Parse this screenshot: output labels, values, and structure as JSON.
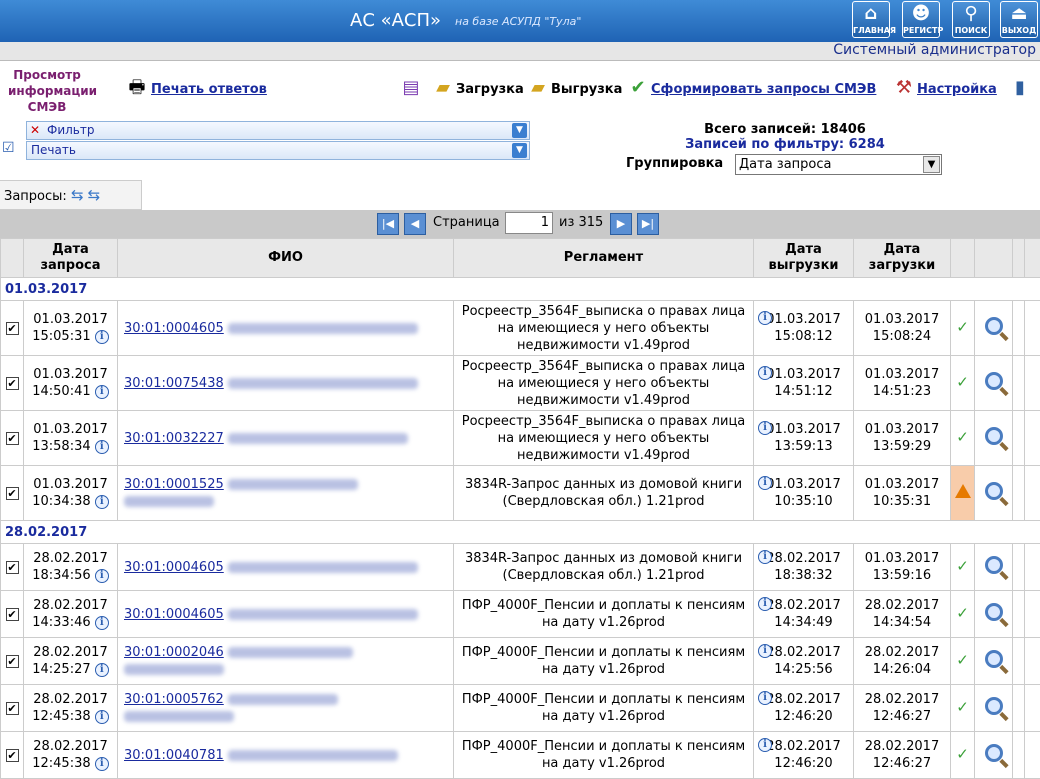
{
  "header": {
    "title": "АС «АСП»",
    "subtitle": "на базе АСУПД \"Тула\"",
    "buttons": [
      {
        "label": "ГЛАВНАЯ",
        "icon": "home-icon"
      },
      {
        "label": "РЕГИСТР",
        "icon": "register-icon"
      },
      {
        "label": "ПОИСК",
        "icon": "search-icon"
      },
      {
        "label": "ВЫХОД",
        "icon": "exit-icon"
      }
    ],
    "user": "Системный администратор"
  },
  "toolbar": {
    "view_title": "Просмотр информации СМЭВ",
    "print_answers": "Печать ответов",
    "upload": "Загрузка",
    "download": "Выгрузка",
    "form_requests": "Сформировать запросы СМЭВ",
    "settings": "Настройка"
  },
  "filters": {
    "filter": "Фильтр",
    "print": "Печать",
    "total": "Всего записей: 18406",
    "by_filter": "Записей по фильтру: 6284",
    "grouping_label": "Группировка",
    "grouping_value": "Дата запроса"
  },
  "requests_tab": "Запросы:",
  "pager": {
    "label": "Страница",
    "page": "1",
    "of": "из 315"
  },
  "columns": [
    "Дата запроса",
    "ФИО",
    "Регламент",
    "Дата выгрузки",
    "Дата загрузки"
  ],
  "groups": [
    {
      "date": "01.03.2017"
    },
    {
      "date": "28.02.2017"
    }
  ],
  "rows": [
    {
      "d1": "01.03.2017",
      "t1": "15:05:31",
      "id": "30:01:0004605",
      "reg": "Росреестр_3564F_выписка о правах лица на имеющиеся у него объекты недвижимости v1.49prod",
      "d2": "01.03.2017",
      "t2": "15:08:12",
      "d3": "01.03.2017",
      "t3": "15:08:24",
      "status": "ok"
    },
    {
      "d1": "01.03.2017",
      "t1": "14:50:41",
      "id": "30:01:0075438",
      "reg": "Росреестр_3564F_выписка о правах лица на имеющиеся у него объекты недвижимости v1.49prod",
      "d2": "01.03.2017",
      "t2": "14:51:12",
      "d3": "01.03.2017",
      "t3": "14:51:23",
      "status": "ok"
    },
    {
      "d1": "01.03.2017",
      "t1": "13:58:34",
      "id": "30:01:0032227",
      "reg": "Росреестр_3564F_выписка о правах лица на имеющиеся у него объекты недвижимости v1.49prod",
      "d2": "01.03.2017",
      "t2": "13:59:13",
      "d3": "01.03.2017",
      "t3": "13:59:29",
      "status": "ok"
    },
    {
      "d1": "01.03.2017",
      "t1": "10:34:38",
      "id": "30:01:0001525",
      "reg": "3834R-Запрос данных из домовой книги (Свердловская обл.) 1.21prod",
      "d2": "01.03.2017",
      "t2": "10:35:10",
      "d3": "01.03.2017",
      "t3": "10:35:31",
      "status": "warn"
    },
    {
      "d1": "28.02.2017",
      "t1": "18:34:56",
      "id": "30:01:0004605",
      "reg": "3834R-Запрос данных из домовой книги (Свердловская обл.) 1.21prod",
      "d2": "28.02.2017",
      "t2": "18:38:32",
      "d3": "01.03.2017",
      "t3": "13:59:16",
      "status": "ok"
    },
    {
      "d1": "28.02.2017",
      "t1": "14:33:46",
      "id": "30:01:0004605",
      "reg": "ПФР_4000F_Пенсии и доплаты к пенсиям на дату v1.26prod",
      "d2": "28.02.2017",
      "t2": "14:34:49",
      "d3": "28.02.2017",
      "t3": "14:34:54",
      "status": "ok"
    },
    {
      "d1": "28.02.2017",
      "t1": "14:25:27",
      "id": "30:01:0002046",
      "reg": "ПФР_4000F_Пенсии и доплаты к пенсиям на дату v1.26prod",
      "d2": "28.02.2017",
      "t2": "14:25:56",
      "d3": "28.02.2017",
      "t3": "14:26:04",
      "status": "ok"
    },
    {
      "d1": "28.02.2017",
      "t1": "12:45:38",
      "id": "30:01:0005762",
      "reg": "ПФР_4000F_Пенсии и доплаты к пенсиям на дату v1.26prod",
      "d2": "28.02.2017",
      "t2": "12:46:20",
      "d3": "28.02.2017",
      "t3": "12:46:27",
      "status": "ok"
    },
    {
      "d1": "28.02.2017",
      "t1": "12:45:38",
      "id": "30:01:0040781",
      "reg": "ПФР_4000F_Пенсии и доплаты к пенсиям на дату v1.26prod",
      "d2": "28.02.2017",
      "t2": "12:46:20",
      "d3": "28.02.2017",
      "t3": "12:46:27",
      "status": "ok"
    }
  ]
}
